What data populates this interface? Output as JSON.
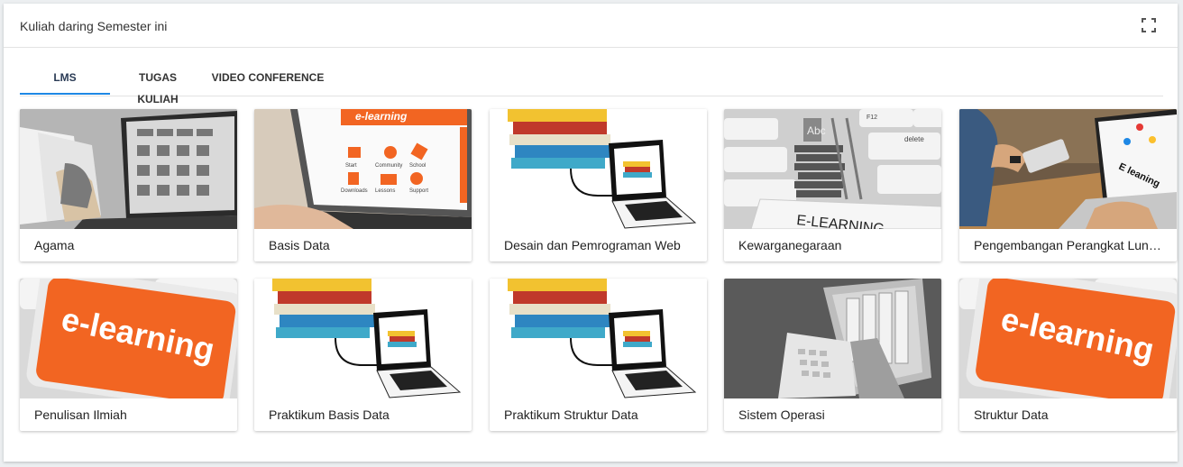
{
  "panel": {
    "title": "Kuliah daring Semester ini",
    "expand_icon": "fullscreen-icon"
  },
  "tabs": [
    {
      "label": "LMS",
      "active": true
    },
    {
      "label": "TUGAS KULIAH",
      "active": false
    },
    {
      "label": "VIDEO CONFERENCE",
      "active": false
    }
  ],
  "courses": [
    {
      "name": "Agama",
      "thumbnail": "laptop-book-photo"
    },
    {
      "name": "Basis Data",
      "thumbnail": "elearning-laptop-screen",
      "screen_text": "e-learning",
      "menu_items": [
        "Start",
        "Community",
        "School",
        "Downloads",
        "Lessons",
        "Support"
      ]
    },
    {
      "name": "Desain dan Pemrograman Web",
      "thumbnail": "books-laptop-illustration"
    },
    {
      "name": "Kewarganegaraan",
      "thumbnail": "keyboard-ladder-books",
      "key_text": "E-LEARNING",
      "key_labels": [
        "delete",
        "F12",
        "Abc"
      ]
    },
    {
      "name": "Pengembangan Perangkat Lun…",
      "thumbnail": "person-laptop-photo",
      "screen_text": "E leaning"
    },
    {
      "name": "Penulisan Ilmiah",
      "thumbnail": "orange-elearning-key",
      "key_text": "e-learning"
    },
    {
      "name": "Praktikum Basis Data",
      "thumbnail": "books-laptop-illustration"
    },
    {
      "name": "Praktikum Struktur Data",
      "thumbnail": "books-laptop-illustration"
    },
    {
      "name": "Sistem Operasi",
      "thumbnail": "laptop-books-gray"
    },
    {
      "name": "Struktur Data",
      "thumbnail": "orange-elearning-key",
      "key_text": "e-learning"
    }
  ],
  "colors": {
    "accent": "#1e88e5",
    "elearning_orange": "#f26522"
  }
}
